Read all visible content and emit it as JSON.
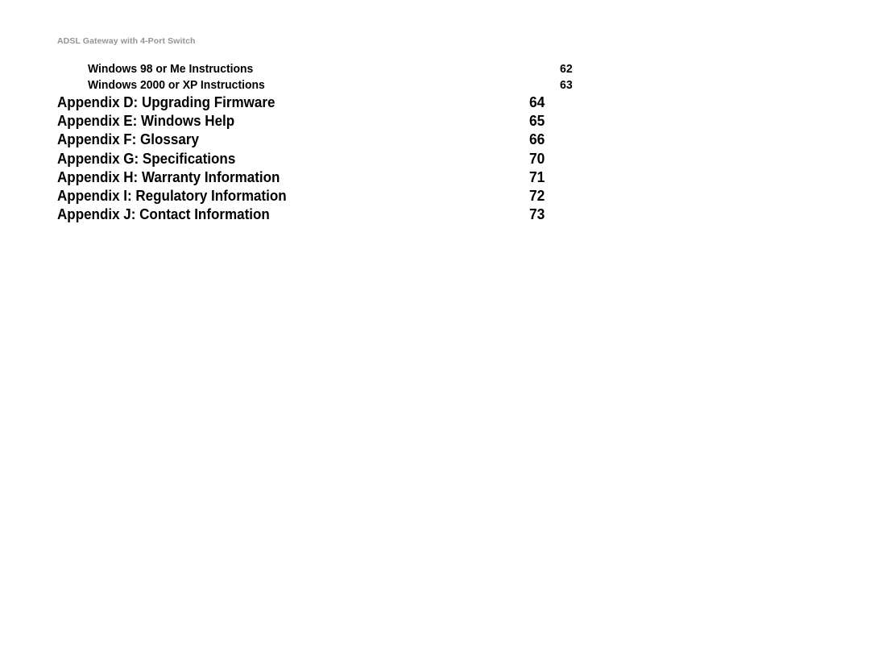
{
  "document": {
    "running_header": "ADSL Gateway with 4-Port Switch",
    "header_color": "#949494",
    "text_color": "#000000",
    "background_color": "#ffffff"
  },
  "toc": {
    "entries": [
      {
        "level": 2,
        "title": "Windows 98 or Me Instructions",
        "page": "62"
      },
      {
        "level": 2,
        "title": "Windows 2000 or XP Instructions",
        "page": "63"
      },
      {
        "level": 1,
        "title": "Appendix D: Upgrading Firmware",
        "page": "64"
      },
      {
        "level": 1,
        "title": "Appendix E: Windows Help",
        "page": "65"
      },
      {
        "level": 1,
        "title": "Appendix F: Glossary",
        "page": "66"
      },
      {
        "level": 1,
        "title": "Appendix G: Specifications",
        "page": "70"
      },
      {
        "level": 1,
        "title": "Appendix H: Warranty Information",
        "page": "71"
      },
      {
        "level": 1,
        "title": "Appendix I: Regulatory Information",
        "page": "72"
      },
      {
        "level": 1,
        "title": "Appendix J: Contact Information",
        "page": "73"
      }
    ]
  }
}
